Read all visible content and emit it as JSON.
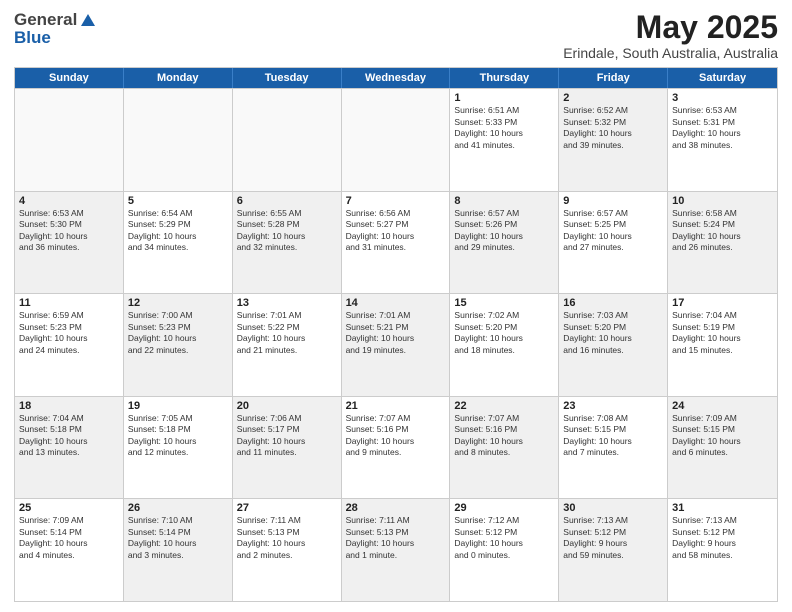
{
  "header": {
    "logo_general": "General",
    "logo_blue": "Blue",
    "month_title": "May 2025",
    "subtitle": "Erindale, South Australia, Australia"
  },
  "day_headers": [
    "Sunday",
    "Monday",
    "Tuesday",
    "Wednesday",
    "Thursday",
    "Friday",
    "Saturday"
  ],
  "weeks": [
    [
      {
        "day": "",
        "info": "",
        "empty": true
      },
      {
        "day": "",
        "info": "",
        "empty": true
      },
      {
        "day": "",
        "info": "",
        "empty": true
      },
      {
        "day": "",
        "info": "",
        "empty": true
      },
      {
        "day": "1",
        "info": "Sunrise: 6:51 AM\nSunset: 5:33 PM\nDaylight: 10 hours\nand 41 minutes."
      },
      {
        "day": "2",
        "info": "Sunrise: 6:52 AM\nSunset: 5:32 PM\nDaylight: 10 hours\nand 39 minutes."
      },
      {
        "day": "3",
        "info": "Sunrise: 6:53 AM\nSunset: 5:31 PM\nDaylight: 10 hours\nand 38 minutes."
      }
    ],
    [
      {
        "day": "4",
        "info": "Sunrise: 6:53 AM\nSunset: 5:30 PM\nDaylight: 10 hours\nand 36 minutes."
      },
      {
        "day": "5",
        "info": "Sunrise: 6:54 AM\nSunset: 5:29 PM\nDaylight: 10 hours\nand 34 minutes."
      },
      {
        "day": "6",
        "info": "Sunrise: 6:55 AM\nSunset: 5:28 PM\nDaylight: 10 hours\nand 32 minutes."
      },
      {
        "day": "7",
        "info": "Sunrise: 6:56 AM\nSunset: 5:27 PM\nDaylight: 10 hours\nand 31 minutes."
      },
      {
        "day": "8",
        "info": "Sunrise: 6:57 AM\nSunset: 5:26 PM\nDaylight: 10 hours\nand 29 minutes."
      },
      {
        "day": "9",
        "info": "Sunrise: 6:57 AM\nSunset: 5:25 PM\nDaylight: 10 hours\nand 27 minutes."
      },
      {
        "day": "10",
        "info": "Sunrise: 6:58 AM\nSunset: 5:24 PM\nDaylight: 10 hours\nand 26 minutes."
      }
    ],
    [
      {
        "day": "11",
        "info": "Sunrise: 6:59 AM\nSunset: 5:23 PM\nDaylight: 10 hours\nand 24 minutes."
      },
      {
        "day": "12",
        "info": "Sunrise: 7:00 AM\nSunset: 5:23 PM\nDaylight: 10 hours\nand 22 minutes."
      },
      {
        "day": "13",
        "info": "Sunrise: 7:01 AM\nSunset: 5:22 PM\nDaylight: 10 hours\nand 21 minutes."
      },
      {
        "day": "14",
        "info": "Sunrise: 7:01 AM\nSunset: 5:21 PM\nDaylight: 10 hours\nand 19 minutes."
      },
      {
        "day": "15",
        "info": "Sunrise: 7:02 AM\nSunset: 5:20 PM\nDaylight: 10 hours\nand 18 minutes."
      },
      {
        "day": "16",
        "info": "Sunrise: 7:03 AM\nSunset: 5:20 PM\nDaylight: 10 hours\nand 16 minutes."
      },
      {
        "day": "17",
        "info": "Sunrise: 7:04 AM\nSunset: 5:19 PM\nDaylight: 10 hours\nand 15 minutes."
      }
    ],
    [
      {
        "day": "18",
        "info": "Sunrise: 7:04 AM\nSunset: 5:18 PM\nDaylight: 10 hours\nand 13 minutes."
      },
      {
        "day": "19",
        "info": "Sunrise: 7:05 AM\nSunset: 5:18 PM\nDaylight: 10 hours\nand 12 minutes."
      },
      {
        "day": "20",
        "info": "Sunrise: 7:06 AM\nSunset: 5:17 PM\nDaylight: 10 hours\nand 11 minutes."
      },
      {
        "day": "21",
        "info": "Sunrise: 7:07 AM\nSunset: 5:16 PM\nDaylight: 10 hours\nand 9 minutes."
      },
      {
        "day": "22",
        "info": "Sunrise: 7:07 AM\nSunset: 5:16 PM\nDaylight: 10 hours\nand 8 minutes."
      },
      {
        "day": "23",
        "info": "Sunrise: 7:08 AM\nSunset: 5:15 PM\nDaylight: 10 hours\nand 7 minutes."
      },
      {
        "day": "24",
        "info": "Sunrise: 7:09 AM\nSunset: 5:15 PM\nDaylight: 10 hours\nand 6 minutes."
      }
    ],
    [
      {
        "day": "25",
        "info": "Sunrise: 7:09 AM\nSunset: 5:14 PM\nDaylight: 10 hours\nand 4 minutes."
      },
      {
        "day": "26",
        "info": "Sunrise: 7:10 AM\nSunset: 5:14 PM\nDaylight: 10 hours\nand 3 minutes."
      },
      {
        "day": "27",
        "info": "Sunrise: 7:11 AM\nSunset: 5:13 PM\nDaylight: 10 hours\nand 2 minutes."
      },
      {
        "day": "28",
        "info": "Sunrise: 7:11 AM\nSunset: 5:13 PM\nDaylight: 10 hours\nand 1 minute."
      },
      {
        "day": "29",
        "info": "Sunrise: 7:12 AM\nSunset: 5:12 PM\nDaylight: 10 hours\nand 0 minutes."
      },
      {
        "day": "30",
        "info": "Sunrise: 7:13 AM\nSunset: 5:12 PM\nDaylight: 9 hours\nand 59 minutes."
      },
      {
        "day": "31",
        "info": "Sunrise: 7:13 AM\nSunset: 5:12 PM\nDaylight: 9 hours\nand 58 minutes."
      }
    ]
  ]
}
